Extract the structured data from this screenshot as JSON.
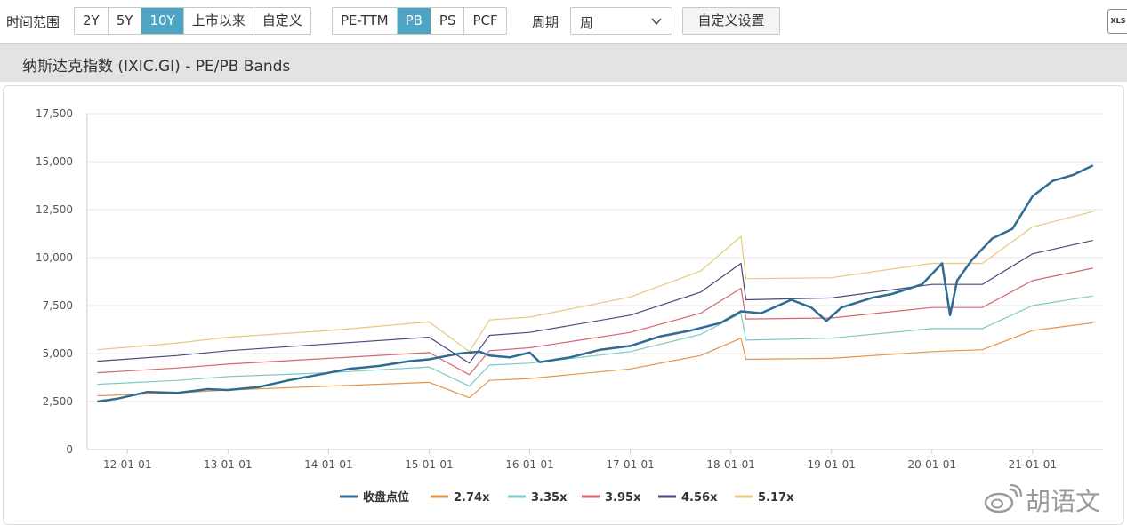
{
  "toolbar": {
    "range_label": "时间范围",
    "range_options": [
      "2Y",
      "5Y",
      "10Y",
      "上市以来",
      "自定义"
    ],
    "range_active": "10Y",
    "metric_options": [
      "PE-TTM",
      "PB",
      "PS",
      "PCF"
    ],
    "metric_active": "PB",
    "period_label": "周期",
    "period_value": "周",
    "settings_label": "自定义设置",
    "export_label": "XLS"
  },
  "title": "纳斯达克指数 (IXIC.GI) - PE/PB Bands",
  "watermark": "胡语文",
  "colors": {
    "accent": "#4ea5c3",
    "close": "#2f6b93",
    "b274": "#e3954e",
    "b335": "#7ec9c7",
    "b395": "#d2686e",
    "b456": "#4b4a7a",
    "b517": "#e7c97e"
  },
  "chart_data": {
    "type": "line",
    "ylim": [
      0,
      17500
    ],
    "yticks": [
      0,
      2500,
      5000,
      7500,
      10000,
      12500,
      15000,
      17500
    ],
    "ytick_labels": [
      "0",
      "2,500",
      "5,000",
      "7,500",
      "10,000",
      "12,500",
      "15,000",
      "17,500"
    ],
    "xlim": [
      2011.6,
      2021.7
    ],
    "xtick_labels": [
      "12-01-01",
      "13-01-01",
      "14-01-01",
      "15-01-01",
      "16-01-01",
      "17-01-01",
      "18-01-01",
      "19-01-01",
      "20-01-01",
      "21-01-01"
    ],
    "xtick_values": [
      2012,
      2013,
      2014,
      2015,
      2016,
      2017,
      2018,
      2019,
      2020,
      2021
    ],
    "legend_position": "bottom",
    "series": [
      {
        "name": "收盘点位",
        "color_key": "close",
        "x": [
          2011.7,
          2011.9,
          2012.2,
          2012.5,
          2012.8,
          2013.0,
          2013.3,
          2013.6,
          2013.9,
          2014.2,
          2014.5,
          2014.8,
          2015.0,
          2015.3,
          2015.5,
          2015.6,
          2015.8,
          2016.0,
          2016.1,
          2016.4,
          2016.7,
          2017.0,
          2017.3,
          2017.6,
          2017.9,
          2018.1,
          2018.3,
          2018.6,
          2018.8,
          2018.95,
          2019.1,
          2019.4,
          2019.6,
          2019.9,
          2020.1,
          2020.18,
          2020.25,
          2020.4,
          2020.6,
          2020.8,
          2021.0,
          2021.2,
          2021.4,
          2021.6
        ],
        "values": [
          2500,
          2650,
          3000,
          2950,
          3150,
          3100,
          3250,
          3600,
          3900,
          4200,
          4350,
          4600,
          4700,
          5000,
          5100,
          4900,
          4800,
          5050,
          4550,
          4800,
          5200,
          5400,
          5900,
          6200,
          6600,
          7200,
          7100,
          7800,
          7400,
          6700,
          7400,
          7900,
          8100,
          8600,
          9700,
          7000,
          8800,
          9900,
          11000,
          11500,
          13200,
          14000,
          14300,
          14800
        ]
      },
      {
        "name": "2.74x",
        "color_key": "b274",
        "x": [
          2011.7,
          2012.5,
          2013.0,
          2014.0,
          2015.0,
          2015.4,
          2015.6,
          2016.0,
          2017.0,
          2017.7,
          2018.1,
          2018.15,
          2019.0,
          2020.0,
          2020.5,
          2021.0,
          2021.6
        ],
        "values": [
          2800,
          2950,
          3100,
          3300,
          3500,
          2700,
          3600,
          3700,
          4200,
          4900,
          5800,
          4700,
          4750,
          5100,
          5200,
          6200,
          6600
        ]
      },
      {
        "name": "3.35x",
        "color_key": "b335",
        "x": [
          2011.7,
          2012.5,
          2013.0,
          2014.0,
          2015.0,
          2015.4,
          2015.6,
          2016.0,
          2017.0,
          2017.7,
          2018.1,
          2018.15,
          2019.0,
          2020.0,
          2020.5,
          2021.0,
          2021.6
        ],
        "values": [
          3400,
          3600,
          3800,
          4000,
          4300,
          3300,
          4400,
          4500,
          5100,
          6000,
          7100,
          5700,
          5800,
          6300,
          6300,
          7500,
          8000
        ]
      },
      {
        "name": "3.95x",
        "color_key": "b395",
        "x": [
          2011.7,
          2012.5,
          2013.0,
          2014.0,
          2015.0,
          2015.4,
          2015.6,
          2016.0,
          2017.0,
          2017.7,
          2018.1,
          2018.15,
          2019.0,
          2020.0,
          2020.5,
          2021.0,
          2021.6
        ],
        "values": [
          4000,
          4250,
          4450,
          4750,
          5050,
          3900,
          5150,
          5300,
          6100,
          7100,
          8400,
          6800,
          6850,
          7400,
          7400,
          8800,
          9450
        ]
      },
      {
        "name": "4.56x",
        "color_key": "b456",
        "x": [
          2011.7,
          2012.5,
          2013.0,
          2014.0,
          2015.0,
          2015.4,
          2015.6,
          2016.0,
          2017.0,
          2017.7,
          2018.1,
          2018.15,
          2019.0,
          2020.0,
          2020.5,
          2021.0,
          2021.6
        ],
        "values": [
          4600,
          4900,
          5150,
          5500,
          5850,
          4500,
          5950,
          6100,
          7000,
          8200,
          9700,
          7800,
          7900,
          8600,
          8600,
          10200,
          10900
        ]
      },
      {
        "name": "5.17x",
        "color_key": "b517",
        "x": [
          2011.7,
          2012.5,
          2013.0,
          2014.0,
          2015.0,
          2015.4,
          2015.6,
          2016.0,
          2017.0,
          2017.7,
          2018.1,
          2018.15,
          2019.0,
          2020.0,
          2020.5,
          2021.0,
          2021.6
        ],
        "values": [
          5200,
          5550,
          5850,
          6200,
          6650,
          5100,
          6750,
          6900,
          7950,
          9300,
          11100,
          8900,
          8950,
          9700,
          9700,
          11600,
          12400
        ]
      }
    ]
  }
}
